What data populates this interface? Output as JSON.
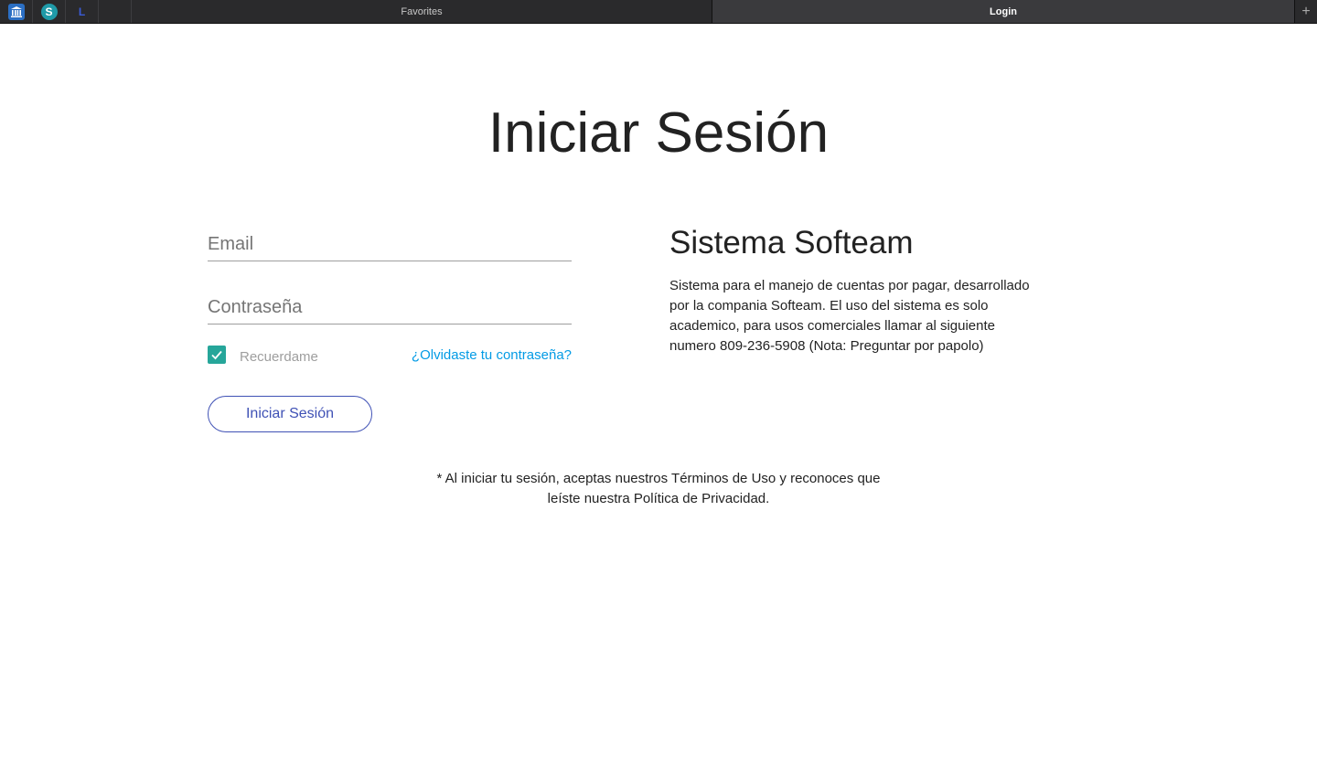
{
  "browser": {
    "favorites_icons": [
      "bank-icon",
      "s-logo-icon",
      "l-logo-icon",
      "microsoft-icon"
    ],
    "tabs": [
      {
        "label": "Favorites",
        "active": false
      },
      {
        "label": "Login",
        "active": true
      }
    ],
    "new_tab_label": "+"
  },
  "page": {
    "title": "Iniciar Sesión"
  },
  "form": {
    "email_placeholder": "Email",
    "password_placeholder": "Contraseña",
    "remember_label": "Recuerdame",
    "remember_checked": true,
    "forgot_link": "¿Olvidaste tu contraseña?",
    "submit_label": "Iniciar Sesión"
  },
  "info": {
    "title": "Sistema Softeam",
    "description": "Sistema para el manejo de cuentas por pagar, desarrollado por la compania Softeam. El uso del sistema es solo academico, para usos comerciales llamar al siguiente numero 809-236-5908 (Nota: Preguntar por papolo)"
  },
  "terms": {
    "text": "* Al iniciar tu sesión, aceptas nuestros Términos de Uso y reconoces que leíste nuestra Política de Privacidad."
  },
  "colors": {
    "checkbox": "#26a69a",
    "link": "#039be5",
    "button_accent": "#3f51b5",
    "tabbar_bg": "#2a2a2c"
  }
}
